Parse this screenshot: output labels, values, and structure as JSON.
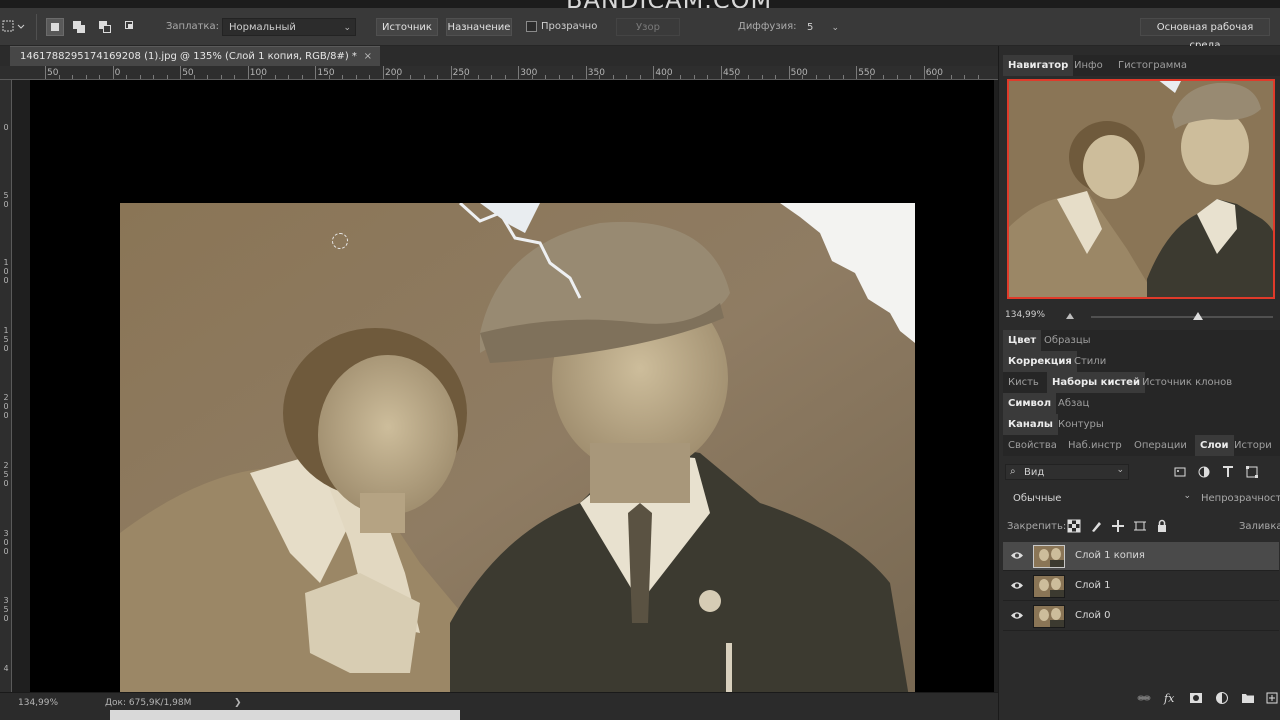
{
  "app": {
    "watermark": "BANDICAM.COM"
  },
  "options_bar": {
    "patch_label": "Заплатка:",
    "patch_mode": "Нормальный",
    "source_button": "Источник",
    "destination_button": "Назначение",
    "transparent_label": "Прозрачно",
    "transparent_checked": false,
    "pattern_button": "Узор",
    "diffusion_label": "Диффузия:",
    "diffusion_value": "5",
    "workspace_button": "Основная рабочая среда"
  },
  "document": {
    "tab_title": "1461788295174169208 (1).jpg @ 135% (Слой 1 копия, RGB/8#) *",
    "close_glyph": "×",
    "ruler_h": [
      "50",
      "0",
      "50",
      "100",
      "150",
      "200",
      "250",
      "300",
      "350",
      "400",
      "450",
      "500",
      "550",
      "600"
    ],
    "ruler_v": [
      "0",
      "5 0",
      "1 0 0",
      "1 5 0",
      "2 0 0",
      "2 5 0",
      "3 0 0",
      "3 5 0",
      "4"
    ]
  },
  "status": {
    "zoom": "134,99%",
    "doc_size": "Док: 675,9K/1,98M",
    "arrow": "❯"
  },
  "panels": {
    "nav_tabs": [
      "Навигатор",
      "Инфо",
      "Гистограмма"
    ],
    "nav_zoom": "134,99%",
    "color_tabs": [
      "Цвет",
      "Образцы"
    ],
    "adjust_tabs": [
      "Коррекция",
      "Стили"
    ],
    "brush_tabs": [
      "Кисть",
      "Наборы кистей",
      "Источник клонов"
    ],
    "char_tabs": [
      "Символ",
      "Абзац"
    ],
    "channel_tabs": [
      "Каналы",
      "Контуры"
    ],
    "layer_tabs": [
      "Свойства",
      "Наб.инстр",
      "Операции",
      "Слои",
      "Истори"
    ],
    "layers": {
      "filter_kind": "Вид",
      "blend_mode": "Обычные",
      "opacity_label": "Непрозрачность",
      "lock_label": "Закрепить:",
      "fill_label": "Заливка",
      "items": [
        {
          "name": "Слой 1 копия",
          "selected": true,
          "visible": true
        },
        {
          "name": "Слой 1",
          "selected": false,
          "visible": true
        },
        {
          "name": "Слой 0",
          "selected": false,
          "visible": true
        }
      ]
    }
  },
  "colors": {
    "accent_red": "#e03a2a",
    "panel_bg": "#2b2b2b",
    "canvas_black": "#000000",
    "photo_sepia": "#8f7c61"
  }
}
